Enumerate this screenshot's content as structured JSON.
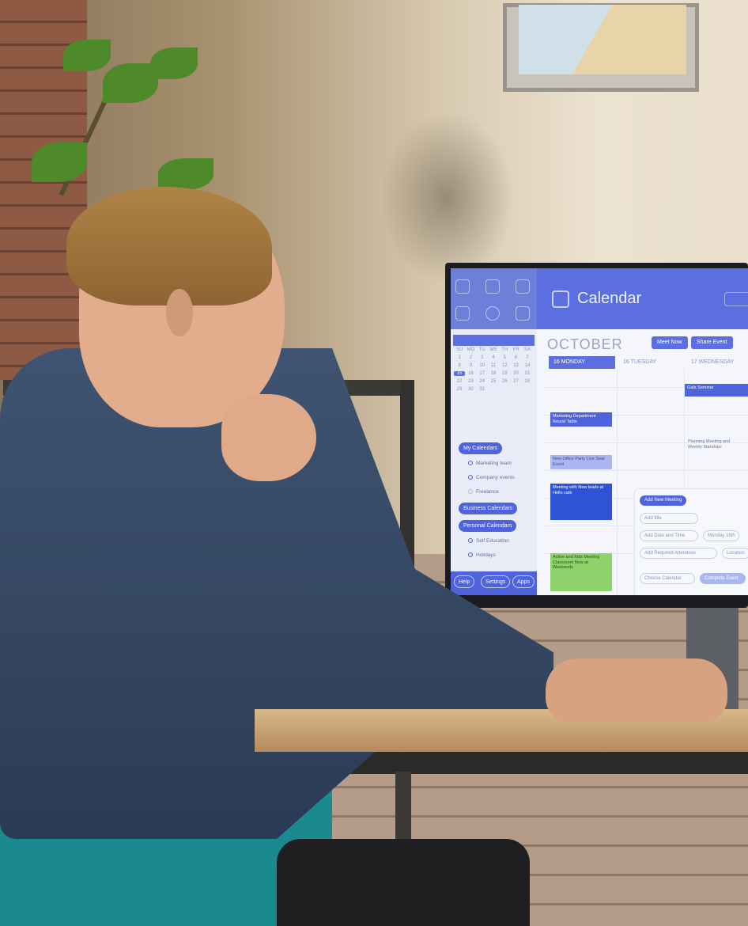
{
  "calendar_app": {
    "title": "Calendar",
    "month": "OCTOBER",
    "top_buttons": [
      "Meet Now",
      "Share Event"
    ],
    "day_headers": [
      "16 MONDAY",
      "16 TUESDAY",
      "17 WEDNESDAY"
    ],
    "mini_calendar": {
      "weekdays": [
        "SU",
        "MO",
        "TU",
        "WE",
        "TH",
        "FR",
        "SA"
      ],
      "days": [
        "1",
        "2",
        "3",
        "4",
        "5",
        "6",
        "7",
        "8",
        "9",
        "10",
        "11",
        "12",
        "13",
        "14",
        "15",
        "16",
        "17",
        "18",
        "19",
        "20",
        "21",
        "22",
        "23",
        "24",
        "25",
        "26",
        "27",
        "28",
        "29",
        "30",
        "31"
      ]
    },
    "sidebar": {
      "my_calendars": "My Calendars",
      "my_calendar_items": [
        "Marketing team",
        "Company events",
        "Freelance"
      ],
      "business_calendars": "Business Calendars",
      "personal_calendars": "Personal Calendars",
      "personal_items": [
        "Self Education",
        "Holidays"
      ],
      "footer": [
        "Help",
        "Settings",
        "Apps"
      ]
    },
    "events": {
      "marketing": "Marketing Department Round Table",
      "office_party": "New Office Party Live Seat Event",
      "meeting_new": "Meeting with New leads at Hello cafe",
      "active_kids": "Active and Kids Meeting Classroom Now at Weekends",
      "gala": "Gala Seminar",
      "planning": "Planning Meeting and Weekly Standups"
    },
    "form": {
      "add_button": "Add New Meeting",
      "title_field": "Add title",
      "date_field": "Add Date and Time",
      "date_value": "Monday 16th",
      "attendees_field": "Add Required Attendees",
      "location_field": "Location",
      "choose_calendar": "Choose Calendar",
      "complete": "Complete Event"
    }
  },
  "colors": {
    "accent": "#5b6fe0",
    "event_green": "#8fd16a",
    "shirt": "#3a4d6b",
    "chair": "#1a8a90"
  }
}
